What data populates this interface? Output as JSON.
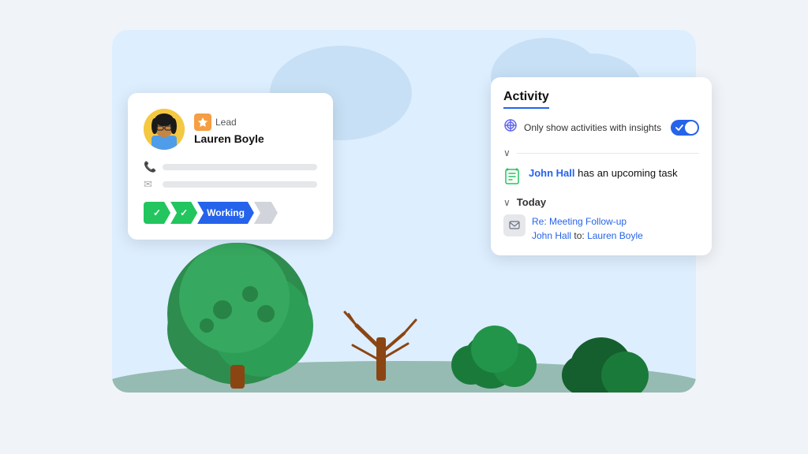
{
  "bg": {
    "color": "#ddeeff"
  },
  "lead_card": {
    "label": "Lead",
    "name": "Lauren Boyle",
    "steps": [
      {
        "label": "✓",
        "state": "done"
      },
      {
        "label": "✓",
        "state": "done"
      },
      {
        "label": "Working",
        "state": "active"
      },
      {
        "label": "",
        "state": "inactive"
      }
    ]
  },
  "activity_panel": {
    "title": "Activity",
    "filter": {
      "text": "Only show activities with insights",
      "toggle_on": true
    },
    "task_item": {
      "name": "John Hall",
      "text": " has an upcoming task"
    },
    "today_section": {
      "label": "Today",
      "email": {
        "subject": "Re: Meeting Follow-up",
        "from_name": "John Hall",
        "to_label": "to:",
        "to_name": "Lauren Boyle"
      }
    }
  }
}
